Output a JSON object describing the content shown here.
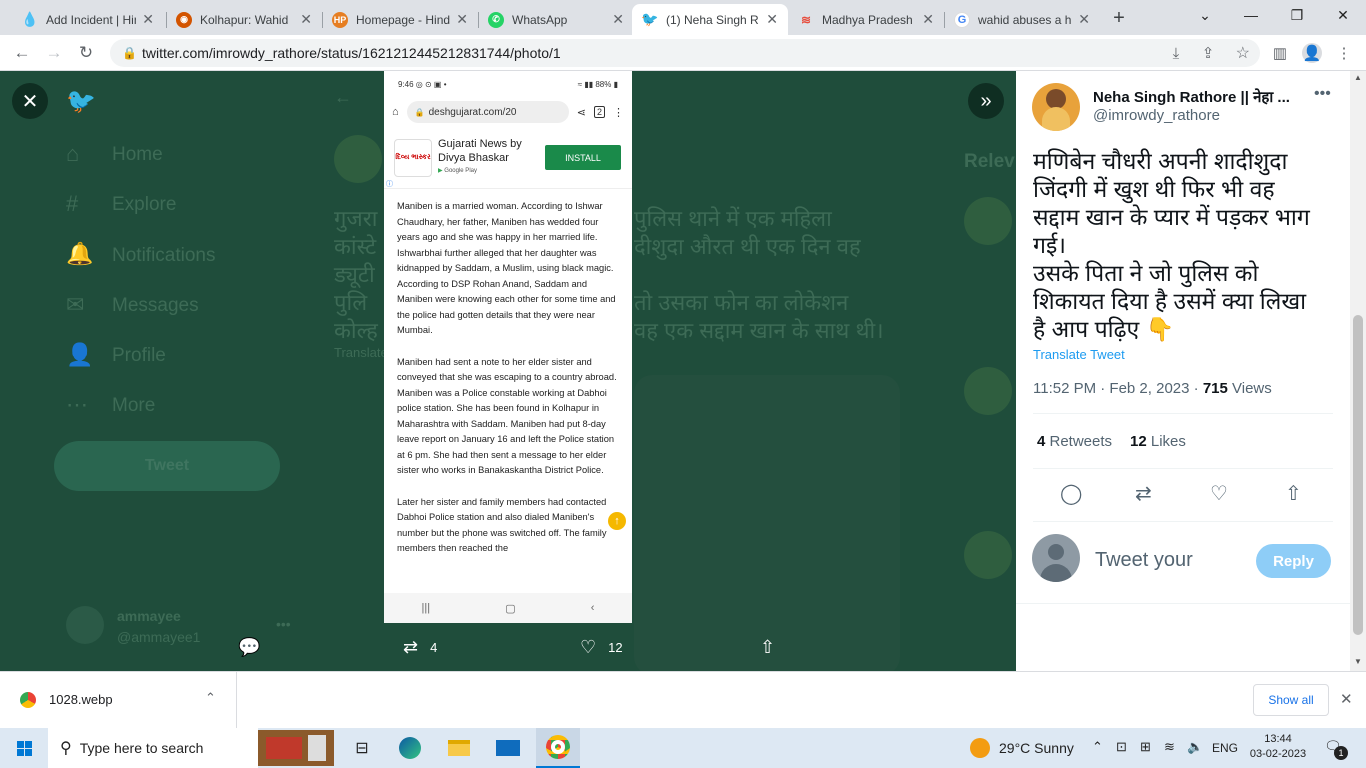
{
  "browser": {
    "tabs": [
      {
        "label": "Add Incident | Hin",
        "icon": "drop-icon",
        "color": "#c0392b"
      },
      {
        "label": "Kolhapur: Wahid",
        "icon": "kolhapur-icon",
        "color": "#d35400"
      },
      {
        "label": "Homepage - Hind",
        "icon": "hindu-post-icon",
        "color": "#e67e22"
      },
      {
        "label": "WhatsApp",
        "icon": "whatsapp-icon",
        "color": "#25d366"
      },
      {
        "label": "(1) Neha Singh R",
        "icon": "twitter-icon",
        "color": "#1d9bf0"
      },
      {
        "label": "Madhya Pradesh",
        "icon": "madhya-pradesh-icon",
        "color": "#e74c3c"
      },
      {
        "label": "wahid abuses a h",
        "icon": "google-icon",
        "color": "#4285f4"
      }
    ],
    "url": "twitter.com/imrowdy_rathore/status/1621212445212831744/photo/1"
  },
  "twitter_bg": {
    "nav": [
      "Home",
      "Explore",
      "Notifications",
      "Messages",
      "Profile",
      "More"
    ],
    "tweet_button": "Tweet",
    "account_name": "ammayee",
    "account_handle": "@ammayee1",
    "relevant": "Relev",
    "translate_fragment": "Translate",
    "hindi_fragment_1": "गुजरा",
    "hindi_fragment_2": "पुलिस थाने में एक महिला",
    "hindi_fragment_3": "कांस्टे",
    "hindi_fragment_4": "दीशुदा औरत थी एक दिन वह",
    "hindi_fragment_5": "ड्यूटी",
    "hindi_fragment_6": "पुलि",
    "hindi_fragment_7": "तो उसका फोन का लोकेशन",
    "hindi_fragment_8": "कोल्ह",
    "hindi_fragment_9": "वह एक सद्दाम खान के साथ थी।"
  },
  "photo": {
    "status_time": "9:46",
    "status_battery": "88%",
    "phone_url": "deshgujarat.com/20",
    "tab_count": "2",
    "ad_title": "Gujarati News by Divya Bhaskar",
    "ad_logo": "દિવ્ય ભાસ્કર",
    "ad_store": "Google Play",
    "ad_button": "INSTALL",
    "paragraphs": [
      "Maniben is a married woman. According to Ishwar Chaudhary, her father, Maniben has wedded four years ago and she was happy in her married life. Ishwarbhai further alleged that her daughter was kidnapped by Saddam, a Muslim, using black magic. According to DSP Rohan Anand, Saddam and Maniben were knowing each other for some time and the police had gotten details that they were near Mumbai.",
      "Maniben had sent a note to her elder sister and conveyed that she was escaping to a country abroad. Maniben was a Police constable working at Dabhoi police station. She has been found in Kolhapur in Maharashtra with Saddam. Maniben had put 8-day leave report on January 16 and left the Police station at 6 pm. She had then sent a message to her elder sister who works in Banakaskantha District Police.",
      "Later her sister and family members had contacted Dabhoi Police station and also dialed Maniben's number but the phone was switched off. The family members then reached the"
    ]
  },
  "photo_actions": {
    "retweets": "4",
    "likes": "12"
  },
  "tweet": {
    "author_name": "Neha Singh Rathore || नेहा ...",
    "author_handle": "@imrowdy_rathore",
    "text_line_1": "मणिबेन चौधरी अपनी शादीशुदा",
    "text_line_2": "जिंदगी में खुश थी फिर भी वह",
    "text_line_3": "सद्दाम खान के प्यार में पड़कर भाग",
    "text_line_4": "गई।",
    "text_line_5": "उसके पिता ने जो पुलिस को",
    "text_line_6": "शिकायत दिया है उसमें क्या लिखा",
    "text_line_7": "है आप पढ़िए 👇",
    "translate": "Translate Tweet",
    "timestamp": "11:52 PM · Feb 2, 2023 · ",
    "views_count": "715",
    "views_label": " Views",
    "retweets_count": "4",
    "retweets_label": " Retweets",
    "likes_count": "12",
    "likes_label": " Likes",
    "reply_placeholder": "Tweet your",
    "reply_button": "Reply"
  },
  "download": {
    "filename": "1028.webp",
    "show_all": "Show all"
  },
  "taskbar": {
    "search": "Type here to search",
    "weather": "29°C  Sunny",
    "lang": "ENG",
    "time": "13:44",
    "date": "03-02-2023",
    "notifications": "1"
  }
}
